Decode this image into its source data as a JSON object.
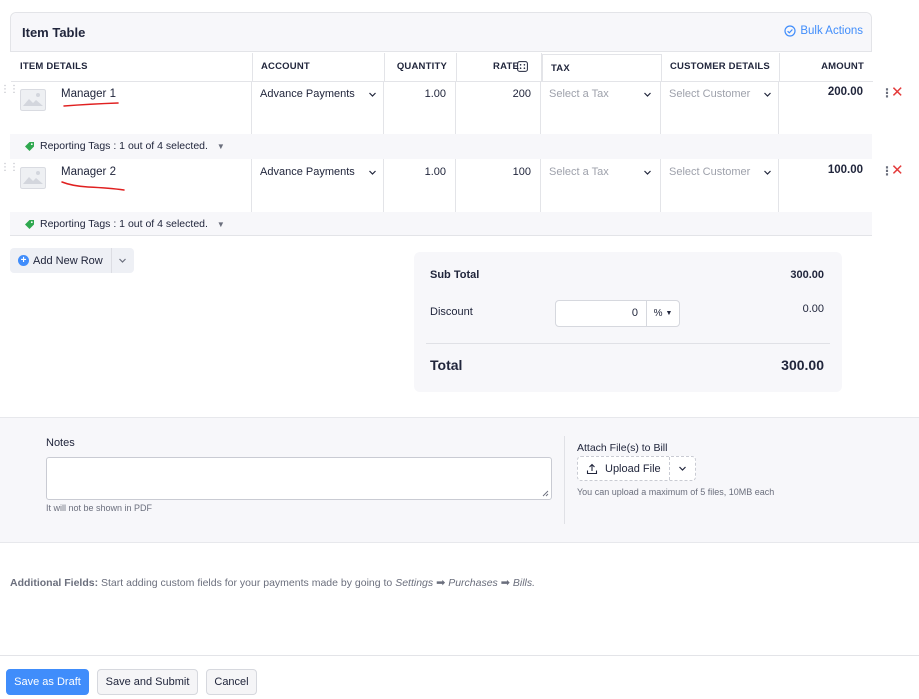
{
  "item_table": {
    "title": "Item Table",
    "bulk_actions": "Bulk Actions",
    "columns": {
      "item_details": "ITEM DETAILS",
      "account": "ACCOUNT",
      "quantity": "QUANTITY",
      "rate": "RATE",
      "tax": "TAX",
      "customer_details": "CUSTOMER DETAILS",
      "amount": "AMOUNT"
    },
    "rows": [
      {
        "item": "Manager 1",
        "account": "Advance Payments",
        "quantity": "1.00",
        "rate": "200",
        "tax_placeholder": "Select a Tax",
        "customer_placeholder": "Select Customer",
        "amount": "200.00",
        "reporting_tags": "Reporting Tags : 1 out of 4 selected."
      },
      {
        "item": "Manager 2",
        "account": "Advance Payments",
        "quantity": "1.00",
        "rate": "100",
        "tax_placeholder": "Select a Tax",
        "customer_placeholder": "Select Customer",
        "amount": "100.00",
        "reporting_tags": "Reporting Tags : 1 out of 4 selected."
      }
    ],
    "add_row": "Add New Row"
  },
  "totals": {
    "sub_total_label": "Sub Total",
    "sub_total_value": "300.00",
    "discount_label": "Discount",
    "discount_input": "0",
    "discount_unit": "%",
    "discount_value": "0.00",
    "total_label": "Total",
    "total_value": "300.00"
  },
  "notes": {
    "label": "Notes",
    "hint": "It will not be shown in PDF"
  },
  "attachments": {
    "label": "Attach File(s) to Bill",
    "upload_button": "Upload File",
    "hint": "You can upload a maximum of 5 files, 10MB each"
  },
  "additional_fields": {
    "label": "Additional Fields:",
    "text": "Start adding custom fields for your payments made by going to",
    "path_1": "Settings",
    "path_2": "Purchases",
    "path_3": "Bills."
  },
  "footer": {
    "save_draft": "Save as Draft",
    "save_submit": "Save and Submit",
    "cancel": "Cancel"
  },
  "colors": {
    "accent": "#408dfb",
    "delete": "#e43b3b",
    "annotation": "#e02020",
    "tag": "#2fa84f"
  },
  "icons": [
    "check-circle-icon",
    "calculator-icon",
    "image-placeholder-icon",
    "chevron-down-icon",
    "kebab-icon",
    "close-icon",
    "tag-icon",
    "plus-circle-icon",
    "upload-icon",
    "arrow-right-icon"
  ]
}
